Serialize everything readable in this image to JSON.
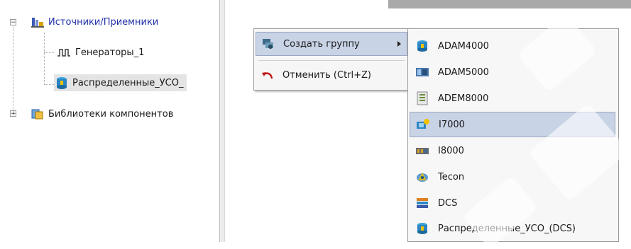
{
  "tree": {
    "root": {
      "label": "Источники/Приемники",
      "expander": "−"
    },
    "children": [
      {
        "label": "Генераторы_1",
        "icon": "generator-signal-icon"
      },
      {
        "label": "Распределенные_УСО_",
        "icon": "distributed-io-icon"
      }
    ],
    "library": {
      "label": "Библиотеки компонентов",
      "expander": "+"
    }
  },
  "context_menu": {
    "items": [
      {
        "label": "Создать группу",
        "icon": "create-group-icon",
        "has_submenu": true
      },
      {
        "label": "Отменить (Ctrl+Z)",
        "icon": "undo-icon"
      }
    ]
  },
  "submenu": {
    "items": [
      {
        "label": "ADAM4000",
        "icon": "adam4000-icon"
      },
      {
        "label": "ADAM5000",
        "icon": "adam5000-icon"
      },
      {
        "label": "ADEM8000",
        "icon": "adem8000-icon"
      },
      {
        "label": "I7000",
        "icon": "i7000-icon",
        "highlighted": true
      },
      {
        "label": "I8000",
        "icon": "i8000-icon"
      },
      {
        "label": "Tecon",
        "icon": "tecon-icon"
      },
      {
        "label": "DCS",
        "icon": "dcs-icon"
      },
      {
        "label": "Распределенные_УСО_(DCS)",
        "icon": "distributed-io-dcs-icon"
      }
    ]
  },
  "colors": {
    "highlight": "#c9d3e6",
    "tree_root_text": "#1f2fa8",
    "header_strip": "#a9a9a9"
  }
}
